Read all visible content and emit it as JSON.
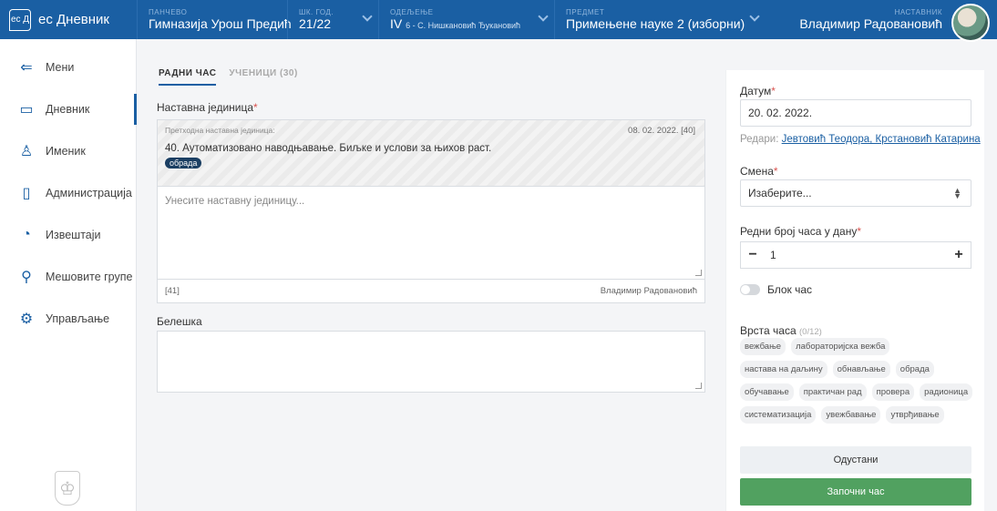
{
  "brand": {
    "logo": "ec Д",
    "name": "ес Дневник"
  },
  "topbar": {
    "school": {
      "label": "ПАНЧЕВО",
      "value": "Гимназија Урош Предић"
    },
    "year": {
      "label": "ШК. ГОД.",
      "value": "21/22"
    },
    "class": {
      "label": "ОДЕЉЕЊЕ",
      "value": "IV",
      "sub": "6",
      "teachers": " - С. Нишкановић Ђукановић"
    },
    "subject": {
      "label": "ПРЕДМЕТ",
      "value": "Примењене науке 2 (изборни)"
    },
    "teacher": {
      "label": "НАСТАВНИК",
      "value": "Владимир Радовановић"
    }
  },
  "sidebar": {
    "items": [
      {
        "label": "Мени",
        "icon": "back-arrow-icon"
      },
      {
        "label": "Дневник",
        "icon": "book-icon"
      },
      {
        "label": "Именик",
        "icon": "users-icon"
      },
      {
        "label": "Администрација",
        "icon": "clipboard-icon"
      },
      {
        "label": "Извештаји",
        "icon": "pie-chart-icon"
      },
      {
        "label": "Мешовите групе",
        "icon": "groups-icon"
      },
      {
        "label": "Управљање",
        "icon": "gear-icon"
      }
    ]
  },
  "tabs": {
    "lesson": "РАДНИ ЧАС",
    "students": "УЧЕНИЦИ (30)"
  },
  "unit": {
    "label": "Наставна јединица",
    "prev_label": "Претходна наставна јединица:",
    "prev_date": "08. 02. 2022. [40]",
    "prev_text": "40. Аутоматизовано наводњавање. Биљке и услови за њихов раст.",
    "prev_badge": "обрада",
    "placeholder": "Унесите наставну јединицу...",
    "counter": "[41]",
    "author": "Владимир Радовановић"
  },
  "note": {
    "label": "Белешка"
  },
  "panel": {
    "date_label": "Датум",
    "date_value": "20. 02. 2022.",
    "redari_label": "Редари:",
    "redari_value": "Јевтовић Теодора, Крстановић Катарина",
    "shift_label": "Смена",
    "shift_value": "Изаберите...",
    "order_label": "Редни број часа у дану",
    "order_value": "1",
    "block_label": "Блок час",
    "type_label": "Врста часа",
    "type_count": "(0/12)",
    "types": [
      "вежбање",
      "лабораторијска вежба",
      "настава на даљину",
      "обнављање",
      "обрада",
      "обучавање",
      "практичан рад",
      "провера",
      "радионица",
      "систематизација",
      "увежбавање",
      "утврђивање"
    ],
    "cancel": "Одустани",
    "start": "Започни час"
  }
}
